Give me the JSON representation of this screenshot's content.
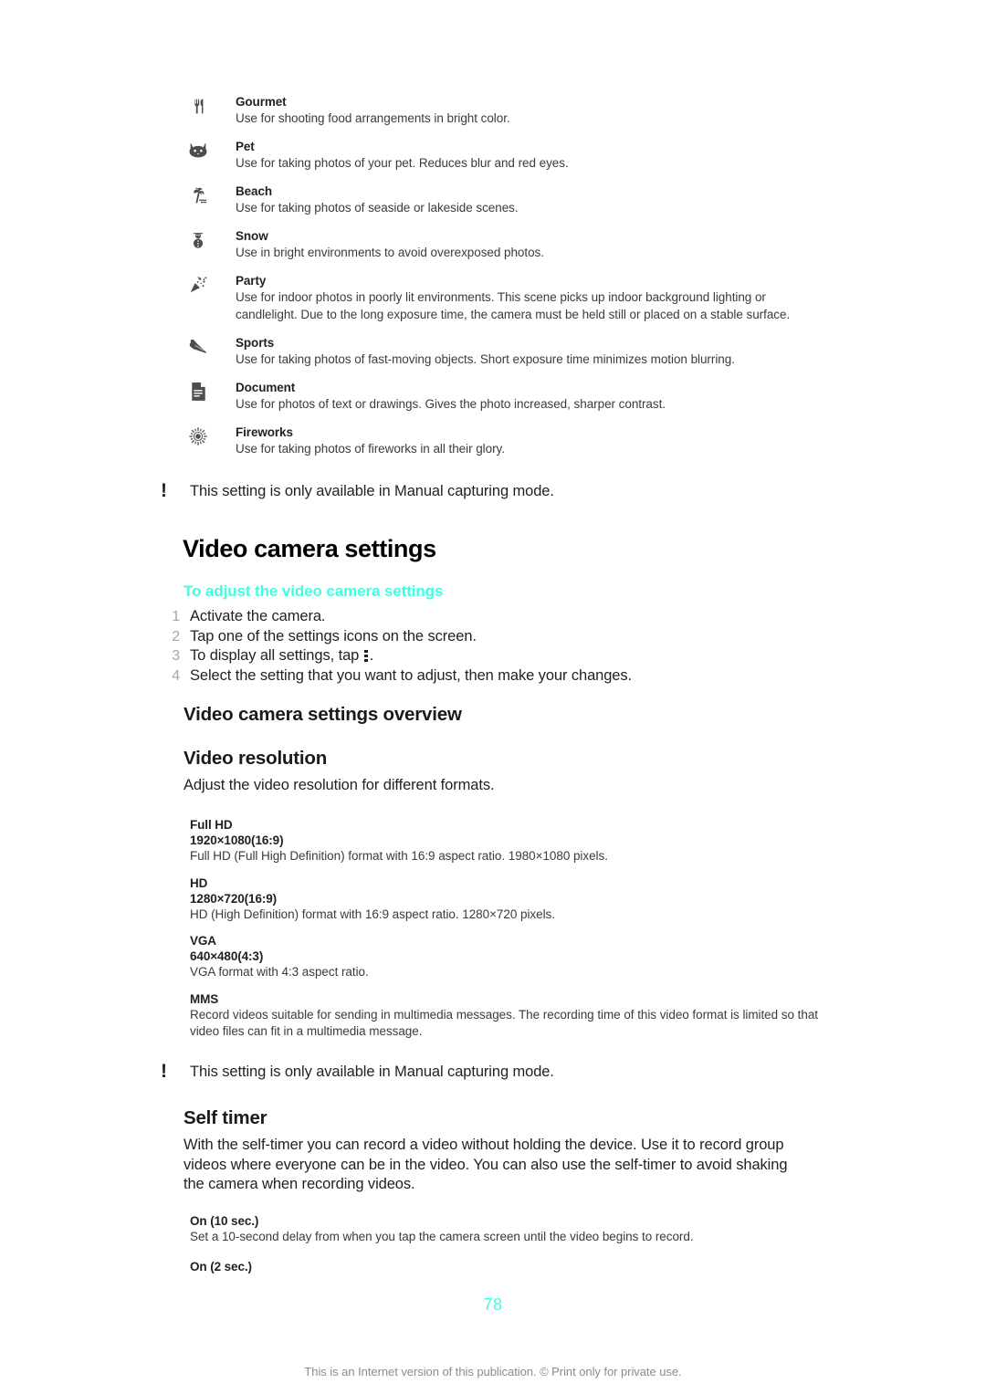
{
  "accent_color": "#3FFFE0",
  "scene_modes": [
    {
      "icon": "fork-knife-icon",
      "name": "Gourmet",
      "description": "Use for shooting food arrangements in bright color."
    },
    {
      "icon": "cat-face-icon",
      "name": "Pet",
      "description": "Use for taking photos of your pet. Reduces blur and red eyes."
    },
    {
      "icon": "palm-tree-icon",
      "name": "Beach",
      "description": "Use for taking photos of seaside or lakeside scenes."
    },
    {
      "icon": "snowman-icon",
      "name": "Snow",
      "description": "Use in bright environments to avoid overexposed photos."
    },
    {
      "icon": "party-popper-icon",
      "name": "Party",
      "description": "Use for indoor photos in poorly lit environments. This scene picks up indoor background lighting or candlelight. Due to the long exposure time, the camera must be held still or placed on a stable surface."
    },
    {
      "icon": "sports-runner-icon",
      "name": "Sports",
      "description": "Use for taking photos of fast-moving objects. Short exposure time minimizes motion blurring."
    },
    {
      "icon": "document-page-icon",
      "name": "Document",
      "description": "Use for photos of text or drawings. Gives the photo increased, sharper contrast."
    },
    {
      "icon": "fireworks-burst-icon",
      "name": "Fireworks",
      "description": "Use for taking photos of fireworks in all their glory."
    }
  ],
  "note_1": {
    "icon": "exclamation-icon",
    "text": "This setting is only available in Manual capturing mode."
  },
  "section_video_camera": {
    "heading": "Video camera settings",
    "task_heading": "To adjust the video camera settings",
    "steps": [
      {
        "num": "1",
        "text_before": "Activate the camera.",
        "has_icon": false,
        "text_after": ""
      },
      {
        "num": "2",
        "text_before": "Tap one of the settings icons on the screen.",
        "has_icon": false,
        "text_after": ""
      },
      {
        "num": "3",
        "text_before": "To display all settings, tap ",
        "has_icon": true,
        "text_after": "."
      },
      {
        "num": "4",
        "text_before": "Select the setting that you want to adjust, then make your changes.",
        "has_icon": false,
        "text_after": ""
      }
    ]
  },
  "section_overview": {
    "heading": "Video camera settings overview"
  },
  "section_video_resolution": {
    "heading": "Video resolution",
    "intro": "Adjust the video resolution for different formats.",
    "options": [
      {
        "title": "Full HD",
        "sub": "1920×1080(16:9)",
        "desc": "Full HD (Full High Definition) format with 16:9 aspect ratio. 1980×1080 pixels."
      },
      {
        "title": "HD",
        "sub": "1280×720(16:9)",
        "desc": "HD (High Definition) format with 16:9 aspect ratio. 1280×720 pixels."
      },
      {
        "title": "VGA",
        "sub": "640×480(4:3)",
        "desc": "VGA format with 4:3 aspect ratio."
      },
      {
        "title": "MMS",
        "sub": "",
        "desc": "Record videos suitable for sending in multimedia messages. The recording time of this video format is limited so that video files can fit in a multimedia message."
      }
    ]
  },
  "note_2": {
    "icon": "exclamation-icon",
    "text": "This setting is only available in Manual capturing mode."
  },
  "section_self_timer": {
    "heading": "Self timer",
    "body": "With the self-timer you can record a video without holding the device. Use it to record group videos where everyone can be in the video. You can also use the self-timer to avoid shaking the camera when recording videos.",
    "options": [
      {
        "title": "On (10 sec.)",
        "desc": "Set a 10-second delay from when you tap the camera screen until the video begins to record."
      },
      {
        "title": "On (2 sec.)",
        "desc": ""
      }
    ]
  },
  "footer": {
    "page_number": "78",
    "copyright": "This is an Internet version of this publication. © Print only for private use."
  }
}
